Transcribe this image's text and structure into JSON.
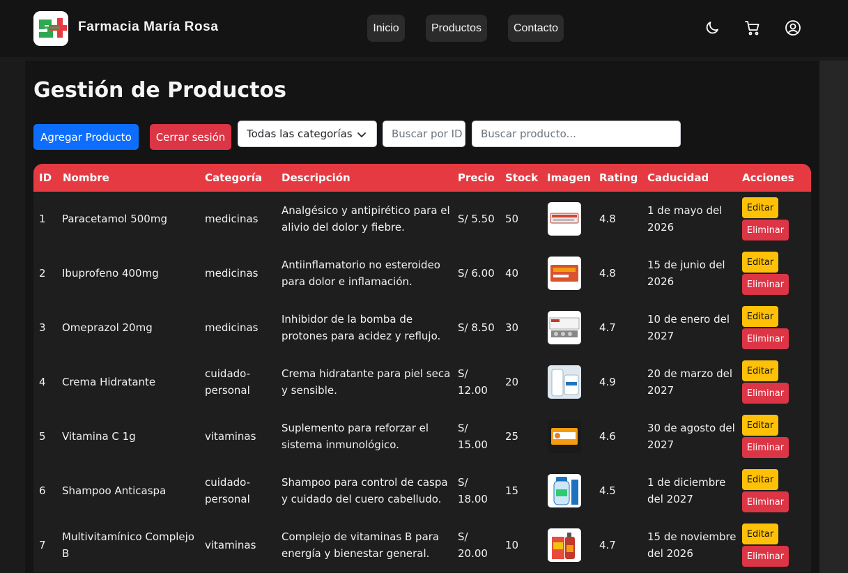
{
  "brand": {
    "name": "Farmacia María Rosa",
    "accent": "#e63a43",
    "logo_green": "#2fa84f"
  },
  "nav": {
    "links": [
      {
        "label": "Inicio"
      },
      {
        "label": "Productos"
      },
      {
        "label": "Contacto"
      }
    ],
    "icons": [
      "moon-icon",
      "cart-icon",
      "user-circle-icon"
    ]
  },
  "page": {
    "title": "Gestión de Productos"
  },
  "toolbar": {
    "add_label": "Agregar Producto",
    "logout_label": "Cerrar sesión",
    "category_selected": "Todas las categorías",
    "search_id_placeholder": "Buscar por ID",
    "search_placeholder": "Buscar producto..."
  },
  "table": {
    "headers": [
      "ID",
      "Nombre",
      "Categoría",
      "Descripción",
      "Precio",
      "Stock",
      "Imagen",
      "Rating",
      "Caducidad",
      "Acciones"
    ],
    "edit_label": "Editar",
    "delete_label": "Eliminar",
    "rows": [
      {
        "id": "1",
        "name": "Paracetamol 500mg",
        "category": "medicinas",
        "description": "Analgésico y antipirético para el alivio del dolor y fiebre.",
        "price": "S/ 5.50",
        "stock": "50",
        "rating": "4.8",
        "expiry": "1 de mayo del 2026"
      },
      {
        "id": "2",
        "name": "Ibuprofeno 400mg",
        "category": "medicinas",
        "description": "Antiinflamatorio no esteroideo para dolor e inflamación.",
        "price": "S/ 6.00",
        "stock": "40",
        "rating": "4.8",
        "expiry": "15 de junio del 2026"
      },
      {
        "id": "3",
        "name": "Omeprazol 20mg",
        "category": "medicinas",
        "description": "Inhibidor de la bomba de protones para acidez y reflujo.",
        "price": "S/ 8.50",
        "stock": "30",
        "rating": "4.7",
        "expiry": "10 de enero del 2027"
      },
      {
        "id": "4",
        "name": "Crema Hidratante",
        "category": "cuidado-personal",
        "description": "Crema hidratante para piel seca y sensible.",
        "price": "S/ 12.00",
        "stock": "20",
        "rating": "4.9",
        "expiry": "20 de marzo del 2027"
      },
      {
        "id": "5",
        "name": "Vitamina C 1g",
        "category": "vitaminas",
        "description": "Suplemento para reforzar el sistema inmunológico.",
        "price": "S/ 15.00",
        "stock": "25",
        "rating": "4.6",
        "expiry": "30 de agosto del 2027"
      },
      {
        "id": "6",
        "name": "Shampoo Anticaspa",
        "category": "cuidado-personal",
        "description": "Shampoo para control de caspa y cuidado del cuero cabelludo.",
        "price": "S/ 18.00",
        "stock": "15",
        "rating": "4.5",
        "expiry": "1 de diciembre del 2027"
      },
      {
        "id": "7",
        "name": "Multivitamínico Complejo B",
        "category": "vitaminas",
        "description": "Complejo de vitaminas B para energía y bienestar general.",
        "price": "S/ 20.00",
        "stock": "10",
        "rating": "4.7",
        "expiry": "15 de noviembre del 2026"
      }
    ]
  }
}
